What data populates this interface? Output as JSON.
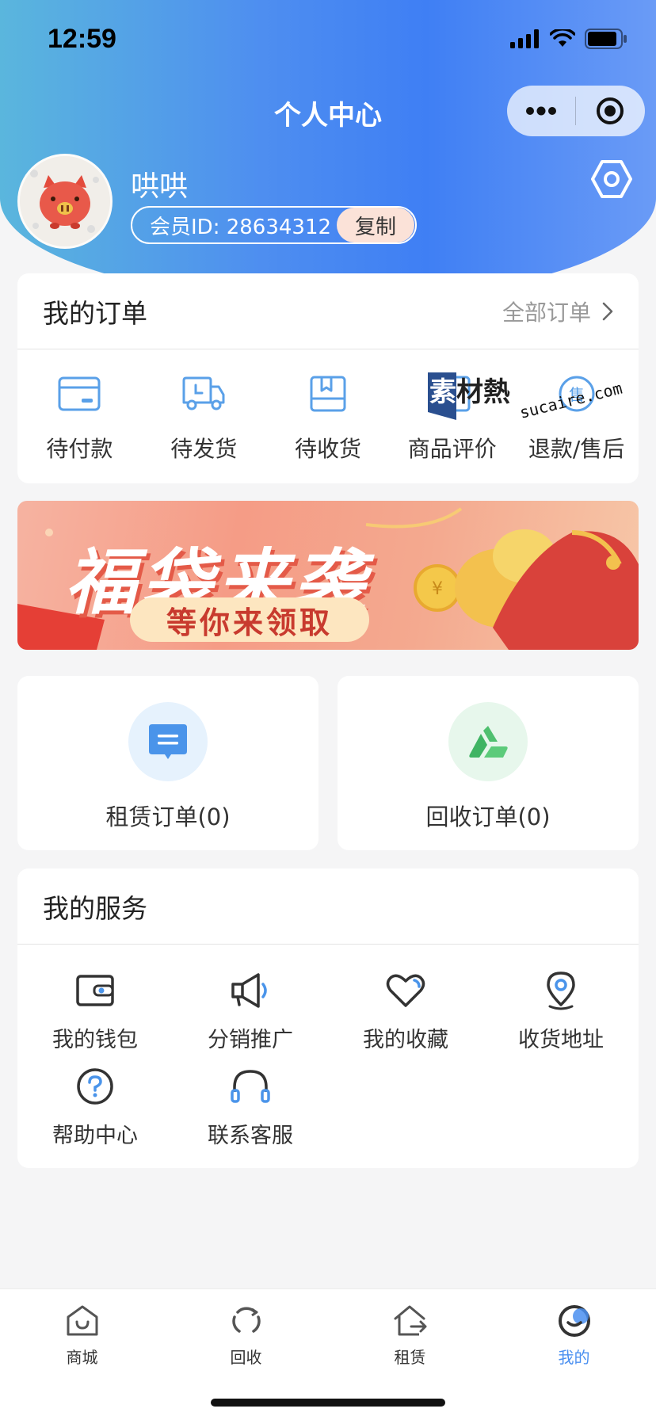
{
  "status_bar": {
    "time": "12:59"
  },
  "navbar": {
    "title": "个人中心"
  },
  "user": {
    "name": "哄哄",
    "member_id": "会员ID: 28634312",
    "copy_label": "复制"
  },
  "orders": {
    "title": "我的订单",
    "all_label": "全部订单",
    "items": [
      {
        "label": "待付款",
        "icon": "card-icon"
      },
      {
        "label": "待发货",
        "icon": "truck-icon"
      },
      {
        "label": "待收货",
        "icon": "box-icon"
      },
      {
        "label": "商品评价",
        "icon": "review-icon"
      },
      {
        "label": "退款/售后",
        "icon": "after-sale-icon"
      }
    ],
    "watermark": {
      "logo": "素材熱",
      "url": "sucaire.com"
    }
  },
  "banner": {
    "title": "福袋来袭",
    "subtitle": "等你来领取"
  },
  "rental_order": {
    "label": "租赁订单(0)",
    "icon": "document-icon"
  },
  "recycle_order": {
    "label": "回收订单(0)",
    "icon": "recycle-icon"
  },
  "services": {
    "title": "我的服务",
    "items": [
      {
        "label": "我的钱包",
        "icon": "wallet-icon"
      },
      {
        "label": "分销推广",
        "icon": "megaphone-icon"
      },
      {
        "label": "我的收藏",
        "icon": "heart-icon"
      },
      {
        "label": "收货地址",
        "icon": "location-icon"
      },
      {
        "label": "帮助中心",
        "icon": "help-icon"
      },
      {
        "label": "联系客服",
        "icon": "headset-icon"
      }
    ]
  },
  "tabbar": {
    "items": [
      {
        "label": "商城",
        "icon": "shop-icon"
      },
      {
        "label": "回收",
        "icon": "recycle-tab-icon"
      },
      {
        "label": "租赁",
        "icon": "rent-icon"
      },
      {
        "label": "我的",
        "icon": "profile-icon",
        "active": true
      }
    ]
  },
  "colors": {
    "accent": "#4a8ff0",
    "header_from": "#5ab6dd",
    "header_to": "#3f7ff4"
  }
}
